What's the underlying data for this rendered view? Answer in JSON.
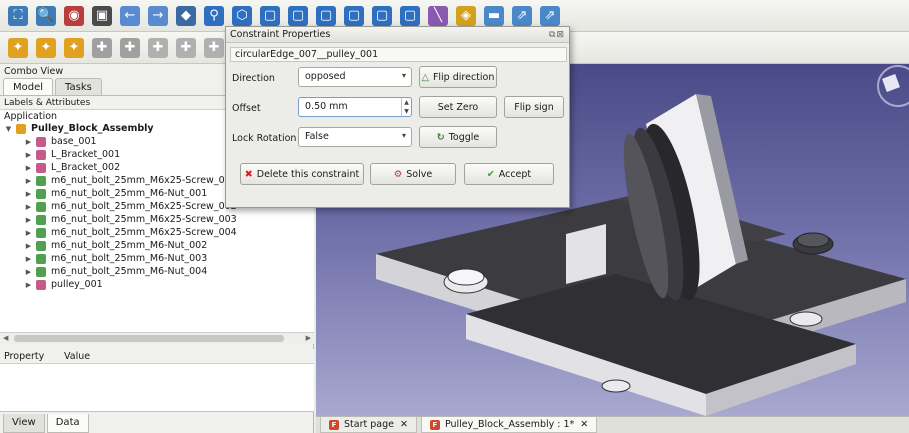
{
  "toolbar1": {
    "icons": [
      {
        "name": "fit-all-icon",
        "color": "#3d7ab8",
        "glyph": "⛶"
      },
      {
        "name": "fit-selection-icon",
        "color": "#3d7ab8",
        "glyph": "🔍"
      },
      {
        "name": "draw-style-icon",
        "color": "#b83d3d",
        "glyph": "◉"
      },
      {
        "name": "bounding-box-icon",
        "color": "#4a4a4a",
        "glyph": "▣"
      },
      {
        "name": "back-icon",
        "color": "#5a8ad0",
        "glyph": "←"
      },
      {
        "name": "forward-icon",
        "color": "#5a8ad0",
        "glyph": "→"
      },
      {
        "name": "workbench-icon",
        "color": "#3a6aa0",
        "glyph": "◆"
      },
      {
        "name": "zoom-icon",
        "color": "#2f6fbf",
        "glyph": "⚲"
      },
      {
        "name": "view-axo-icon",
        "color": "#2f6fbf",
        "glyph": "⬡"
      },
      {
        "name": "view-front-icon",
        "color": "#2f6fbf",
        "glyph": "▢"
      },
      {
        "name": "view-top-icon",
        "color": "#2f6fbf",
        "glyph": "▢"
      },
      {
        "name": "view-right-icon",
        "color": "#2f6fbf",
        "glyph": "▢"
      },
      {
        "name": "view-rear-icon",
        "color": "#2f6fbf",
        "glyph": "▢"
      },
      {
        "name": "view-bottom-icon",
        "color": "#2f6fbf",
        "glyph": "▢"
      },
      {
        "name": "view-left-icon",
        "color": "#2f6fbf",
        "glyph": "▢"
      },
      {
        "name": "measure-icon",
        "color": "#8a5ab0",
        "glyph": "╲"
      },
      {
        "name": "part-icon",
        "color": "#d4a020",
        "glyph": "◈"
      },
      {
        "name": "folder-icon",
        "color": "#4a88c8",
        "glyph": "▬"
      },
      {
        "name": "link-icon",
        "color": "#4a88c8",
        "glyph": "⇗"
      },
      {
        "name": "link-actions-icon",
        "color": "#4a88c8",
        "glyph": "⇗"
      }
    ]
  },
  "toolbar2": {
    "icons": [
      {
        "name": "assembly-icon",
        "color": "#e0a020",
        "glyph": "✦"
      },
      {
        "name": "insert-part-icon",
        "color": "#e0a020",
        "glyph": "✦"
      },
      {
        "name": "add-part-icon",
        "color": "#e0a020",
        "glyph": "✦"
      },
      {
        "name": "point-constraint-icon",
        "color": "#a0a0a0",
        "glyph": "✚"
      },
      {
        "name": "circular-edge-icon",
        "color": "#a0a0a0",
        "glyph": "✚"
      },
      {
        "name": "plane-constraint-icon",
        "color": "#b0b0b0",
        "glyph": "✚"
      },
      {
        "name": "axial-constraint-icon",
        "color": "#b0b0b0",
        "glyph": "✚"
      },
      {
        "name": "angle-constraint-icon",
        "color": "#b0b0b0",
        "glyph": "✚"
      },
      {
        "name": "surface-icon",
        "color": "#909090",
        "glyph": "▰"
      },
      {
        "name": "edge-icon",
        "color": "#909090",
        "glyph": "▰"
      },
      {
        "name": "solve-icon",
        "color": "#909090",
        "glyph": "▰"
      },
      {
        "name": "move-icon",
        "color": "#909090",
        "glyph": "▰"
      },
      {
        "name": "update-icon",
        "color": "#909090",
        "glyph": "▰"
      },
      {
        "name": "autosolve-icon",
        "color": "#c84040",
        "glyph": "⚙"
      },
      {
        "name": "auto-icon",
        "color": "#d84040",
        "glyph": "A"
      },
      {
        "name": "warning-icon",
        "color": "#d0a020",
        "glyph": "⚠"
      },
      {
        "name": "bill-of-materials-icon",
        "color": "#3060a0",
        "glyph": "☰"
      },
      {
        "name": "more-icon",
        "color": "#8a3a3a",
        "glyph": "≫"
      },
      {
        "name": "settings-icon",
        "color": "#606060",
        "glyph": "⚙"
      }
    ]
  },
  "combo_view": {
    "title": "Combo View",
    "tabs": [
      "Model",
      "Tasks"
    ],
    "tree_header": "Labels & Attributes",
    "section": "Application",
    "root": "Pulley_Block_Assembly",
    "items": [
      "base_001",
      "L_Bracket_001",
      "L_Bracket_002",
      "m6_nut_bolt_25mm_M6x25-Screw_001",
      "m6_nut_bolt_25mm_M6-Nut_001",
      "m6_nut_bolt_25mm_M6x25-Screw_002",
      "m6_nut_bolt_25mm_M6x25-Screw_003",
      "m6_nut_bolt_25mm_M6x25-Screw_004",
      "m6_nut_bolt_25mm_M6-Nut_002",
      "m6_nut_bolt_25mm_M6-Nut_003",
      "m6_nut_bolt_25mm_M6-Nut_004",
      "pulley_001"
    ],
    "item_colors": [
      "#c85a8a",
      "#c85a8a",
      "#c85a8a",
      "#4fa04f",
      "#4fa04f",
      "#4fa04f",
      "#4fa04f",
      "#4fa04f",
      "#4fa04f",
      "#4fa04f",
      "#4fa04f",
      "#c85a8a"
    ],
    "property_header": [
      "Property",
      "Value"
    ],
    "bottom_tabs": [
      "View",
      "Data"
    ]
  },
  "dialog": {
    "title": "Constraint Properties",
    "constraint_name": "circularEdge_007__pulley_001",
    "direction_label": "Direction",
    "direction_value": "opposed",
    "flip_direction_label": "Flip direction",
    "offset_label": "Offset",
    "offset_value": "0.50 mm",
    "set_zero_label": "Set Zero",
    "flip_sign_label": "Flip sign",
    "lock_rotation_label": "Lock Rotation",
    "lock_rotation_value": "False",
    "toggle_label": "Toggle",
    "delete_label": "Delete this constraint",
    "solve_label": "Solve",
    "accept_label": "Accept"
  },
  "doc_tabs": [
    {
      "label": "Start page",
      "active": false
    },
    {
      "label": "Pulley_Block_Assembly : 1*",
      "active": true
    }
  ]
}
